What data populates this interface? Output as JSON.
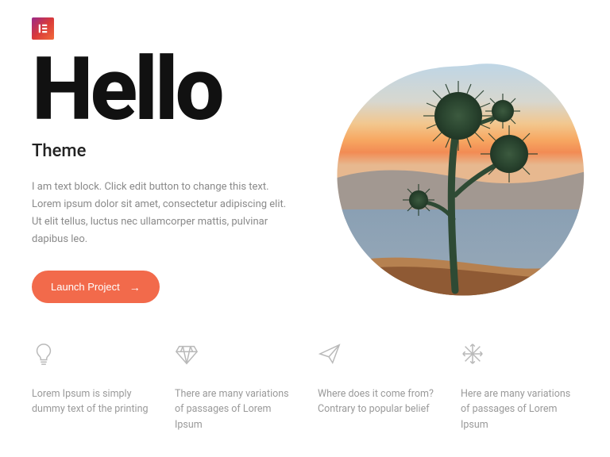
{
  "brand": {
    "logo_name": "elementor-logo"
  },
  "hero": {
    "title": "Hello",
    "subtitle": "Theme",
    "body": "I am text block. Click edit button to change this text. Lorem ipsum dolor sit amet, consectetur adipiscing elit. Ut elit tellus, luctus nec ullamcorper mattis, pulvinar dapibus leo.",
    "cta_label": "Launch Project"
  },
  "features": [
    {
      "icon": "lightbulb-icon",
      "text": "Lorem Ipsum is simply dummy text of the printing"
    },
    {
      "icon": "diamond-icon",
      "text": "There are many variations of passages of Lorem Ipsum"
    },
    {
      "icon": "paperplane-icon",
      "text": "Where does it come from? Contrary to popular belief"
    },
    {
      "icon": "snowflake-icon",
      "text": "Here are many variations of passages of Lorem Ipsum"
    }
  ],
  "colors": {
    "accent": "#f26a4b"
  }
}
